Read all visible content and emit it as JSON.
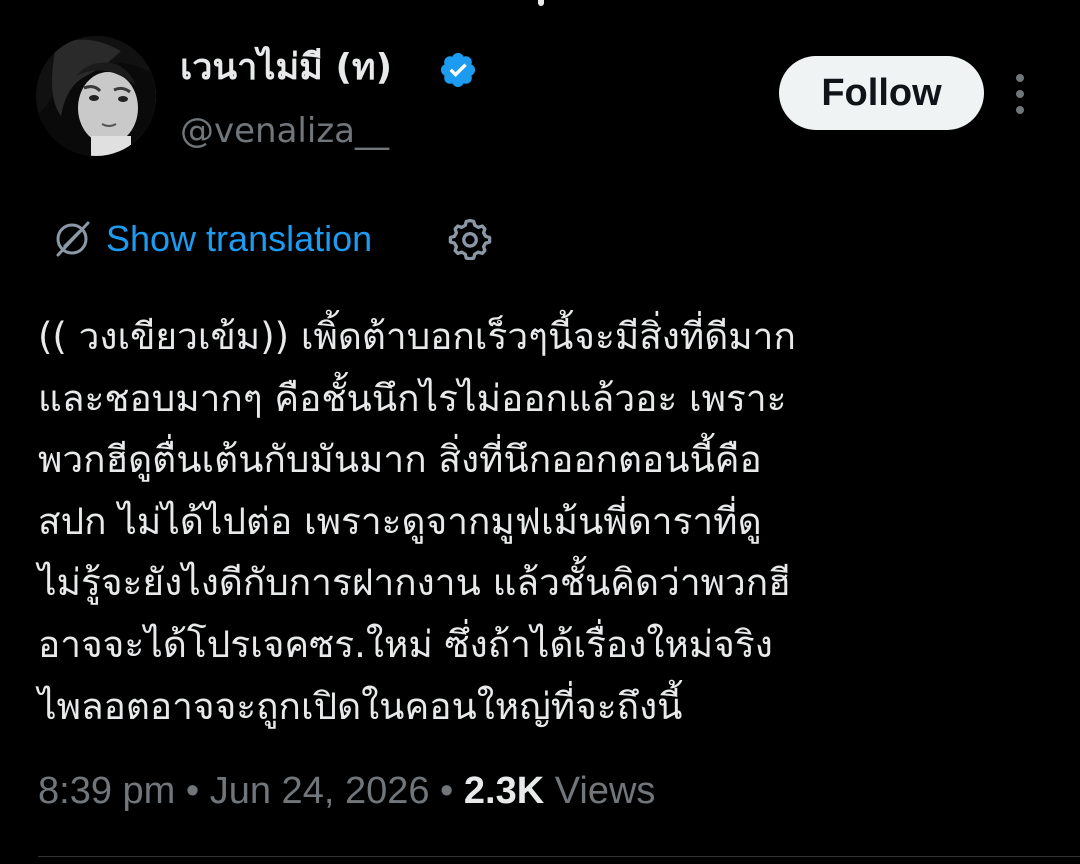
{
  "author": {
    "display_name": "เวนาไม่มี (ท)",
    "handle": "@venaliza__",
    "verified": true
  },
  "actions": {
    "follow_label": "Follow",
    "more_icon": "more-vertical-icon"
  },
  "translation": {
    "label": "Show translation",
    "icon": "globe-off-icon",
    "settings_icon": "gear-icon"
  },
  "tweet": {
    "lines": [
      "(( วงเขียวเข้ม)) เพิ้ดต้าบอกเร็วๆนี้จะมีสิ่งที่ดีมาก",
      "และชอบมากๆ คือชั้นนึกไรไม่ออกแล้วอะ เพราะ",
      "พวกฮีดูตื่นเต้นกับมันมาก สิ่งที่นึกออกตอนนี้คือ",
      "สปก ไม่ได้ไปต่อ เพราะดูจากมูฟเม้นพี่ดาราที่ดู",
      "ไม่รู้จะยังไงดีกับการฝากงาน แล้วชั้นคิดว่าพวกฮี",
      "อาจจะได้โปรเจคซร.ใหม่ ซึ่งถ้าได้เรื่องใหม่จริง",
      "ไพลอตอาจจะถูกเปิดในคอนใหญ่ที่จะถึงนี้"
    ]
  },
  "meta": {
    "time": "8:39 pm",
    "separator": " • ",
    "date": "Jun 24, 2026",
    "views_count": "2.3K",
    "views_label": "Views"
  },
  "colors": {
    "background": "#000000",
    "text": "#e7e9ea",
    "secondary": "#71767b",
    "link": "#1d9bf0",
    "verified": "#1d9bf0",
    "button_bg": "#eff3f4"
  }
}
